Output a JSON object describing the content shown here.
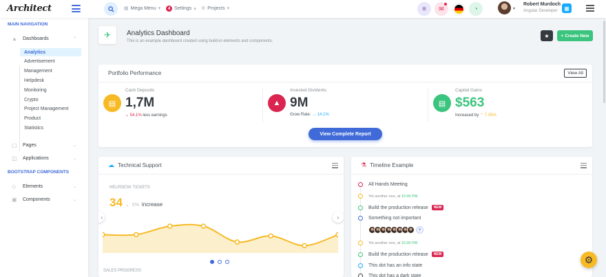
{
  "header": {
    "logo": "Architect",
    "mega_menu": "Mega Menu",
    "settings": "Settings",
    "settings_badge": "4",
    "projects": "Projects",
    "user_name": "Robert Murdoch",
    "user_role": "Angular Developer"
  },
  "sidebar": {
    "main_heading": "MAIN NAVIGATION",
    "dashboards": "Dashboards",
    "sub_items": [
      "Analytics",
      "Advertisement",
      "Management",
      "Helpdesk",
      "Monitoring",
      "Crypto",
      "Project Management",
      "Product",
      "Statistics"
    ],
    "pages": "Pages",
    "applications": "Applications",
    "bootstrap_heading": "BOOTSTRAP COMPONENTS",
    "elements": "Elements",
    "components": "Components"
  },
  "page": {
    "title": "Analytics Dashboard",
    "subtitle": "This is an example dashboard created using build-in elements and components.",
    "create_new": "Create New"
  },
  "portfolio": {
    "title": "Portfolio Performance",
    "view_all": "View All",
    "metrics": [
      {
        "label": "Cash Deposits",
        "value": "1,7M",
        "foot_change": "54.1%",
        "foot_text": "less earnings",
        "color": "#f7b924"
      },
      {
        "label": "Invested Dividents",
        "value": "9M",
        "foot_text": "Grow Rate:",
        "foot_change": "14.1%",
        "color": "#d92550"
      },
      {
        "label": "Capital Gains",
        "value": "$563",
        "foot_text": "Increased by",
        "foot_change": "7.35%",
        "color": "#3ac47d"
      }
    ],
    "report_button": "View Complete Report"
  },
  "support": {
    "title": "Technical Support",
    "section_label": "HELPDESK TICKETS",
    "big_value": "34",
    "pct": "5%",
    "pct_text": "increase",
    "footer_label": "SALES PROGRESS"
  },
  "chart_data": {
    "type": "area",
    "values": [
      30,
      30,
      44,
      44,
      18,
      28,
      12,
      30
    ],
    "ylim": [
      0,
      70
    ],
    "color": "#f7b924"
  },
  "timeline": {
    "title": "Timeline Example",
    "items": [
      {
        "text": "All Hands Meeting",
        "color": "#d92550",
        "small": false
      },
      {
        "text": "Yet another one, at",
        "time": "15:00 PM",
        "color": "#f7b924",
        "small": true
      },
      {
        "text": "Build the production release",
        "badge": "NEW",
        "color": "#3ac47d",
        "small": false
      },
      {
        "text": "Something not important",
        "color": "#3f6ad8",
        "small": false
      },
      {
        "text": "Yet another one, at",
        "time": "15:00 PM",
        "color": "#f7b924",
        "small": true
      },
      {
        "text": "Build the production release",
        "badge": "NEW",
        "color": "#3ac47d",
        "small": false
      },
      {
        "text": "This dot has an info state",
        "color": "#16aaff",
        "small": false
      },
      {
        "text": "This dot has a dark state",
        "color": "#343a40",
        "small": false
      }
    ]
  }
}
